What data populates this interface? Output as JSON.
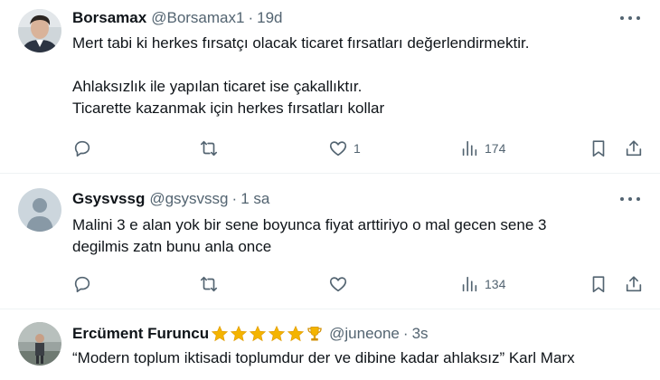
{
  "tweets": [
    {
      "name": "Borsamax",
      "handle": "@Borsamax1",
      "dot": "·",
      "time": "19d",
      "lines": [
        "Mert tabi ki herkes fırsatçı olacak ticaret fırsatları değerlendirmektir.",
        "",
        "Ahlaksızlık ile yapılan ticaret ise çakallıktır.",
        "Ticarette kazanmak için herkes fırsatları kollar"
      ],
      "likes": "1",
      "views": "174"
    },
    {
      "name": "Gsysvssg",
      "handle": "@gsysvssg",
      "dot": "·",
      "time": "1 sa",
      "lines": [
        "Malini 3 e alan  yok bir sene boyunca fiyat arttiriyo o mal gecen sene 3",
        "degilmis zatn bunu anla once"
      ],
      "views": "134"
    },
    {
      "name": "Ercüment Furuncu",
      "badges": [
        "star-icon",
        "star-icon",
        "star-icon",
        "star-icon",
        "star-icon",
        "trophy-icon"
      ],
      "handle": "@juneone",
      "dot": "·",
      "time": "3s",
      "lines": [
        "“Modern toplum iktisadi toplumdur der ve dibine kadar ahlaksız” Karl Marx"
      ]
    }
  ],
  "colors": {
    "text": "#0f1419",
    "secondary": "#536471",
    "divider": "#eff3f4",
    "star": "#f4b400"
  }
}
